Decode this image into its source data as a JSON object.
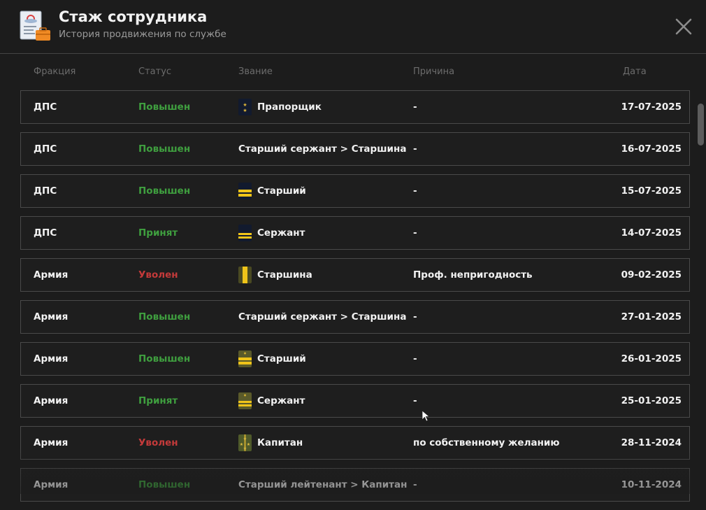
{
  "header": {
    "title": "Стаж сотрудника",
    "subtitle": "История продвижения по службе"
  },
  "columns": {
    "faction": "Фракция",
    "status": "Статус",
    "rank": "Звание",
    "reason": "Причина",
    "date": "Дата"
  },
  "colors": {
    "promoted": "#3f9f3f",
    "dismissed": "#c43a3a",
    "background": "#1c1c1c",
    "border": "#4a4a4a"
  },
  "rows": [
    {
      "faction": "ДПС",
      "status": "Повышен",
      "status_kind": "promoted",
      "rank": "Прапорщик",
      "insignia": "praporshchik-dps-icon",
      "reason": "-",
      "date": "17-07-2025"
    },
    {
      "faction": "ДПС",
      "status": "Повышен",
      "status_kind": "promoted",
      "rank": "Старший сержант > Старшина",
      "insignia": "",
      "reason": "-",
      "date": "16-07-2025"
    },
    {
      "faction": "ДПС",
      "status": "Повышен",
      "status_kind": "promoted",
      "rank": "Старший",
      "insignia": "starshiy-dps-icon",
      "reason": "-",
      "date": "15-07-2025"
    },
    {
      "faction": "ДПС",
      "status": "Принят",
      "status_kind": "promoted",
      "rank": "Сержант",
      "insignia": "serzhant-dps-icon",
      "reason": "-",
      "date": "14-07-2025"
    },
    {
      "faction": "Армия",
      "status": "Уволен",
      "status_kind": "dismissed",
      "rank": "Старшина",
      "insignia": "starshina-army-icon",
      "reason": "Проф. непригодность",
      "date": "09-02-2025"
    },
    {
      "faction": "Армия",
      "status": "Повышен",
      "status_kind": "promoted",
      "rank": "Старший сержант > Старшина",
      "insignia": "",
      "reason": "-",
      "date": "27-01-2025"
    },
    {
      "faction": "Армия",
      "status": "Повышен",
      "status_kind": "promoted",
      "rank": "Старший",
      "insignia": "starshiy-army-icon",
      "reason": "-",
      "date": "26-01-2025"
    },
    {
      "faction": "Армия",
      "status": "Принят",
      "status_kind": "promoted",
      "rank": "Сержант",
      "insignia": "serzhant-army-icon",
      "reason": "-",
      "date": "25-01-2025"
    },
    {
      "faction": "Армия",
      "status": "Уволен",
      "status_kind": "dismissed",
      "rank": "Капитан",
      "insignia": "kapitan-army-icon",
      "reason": "по собственному желанию",
      "date": "28-11-2024"
    },
    {
      "faction": "Армия",
      "status": "Повышен",
      "status_kind": "promoted",
      "rank": "Старший лейтенант > Капитан",
      "insignia": "",
      "reason": "-",
      "date": "10-11-2024"
    }
  ]
}
